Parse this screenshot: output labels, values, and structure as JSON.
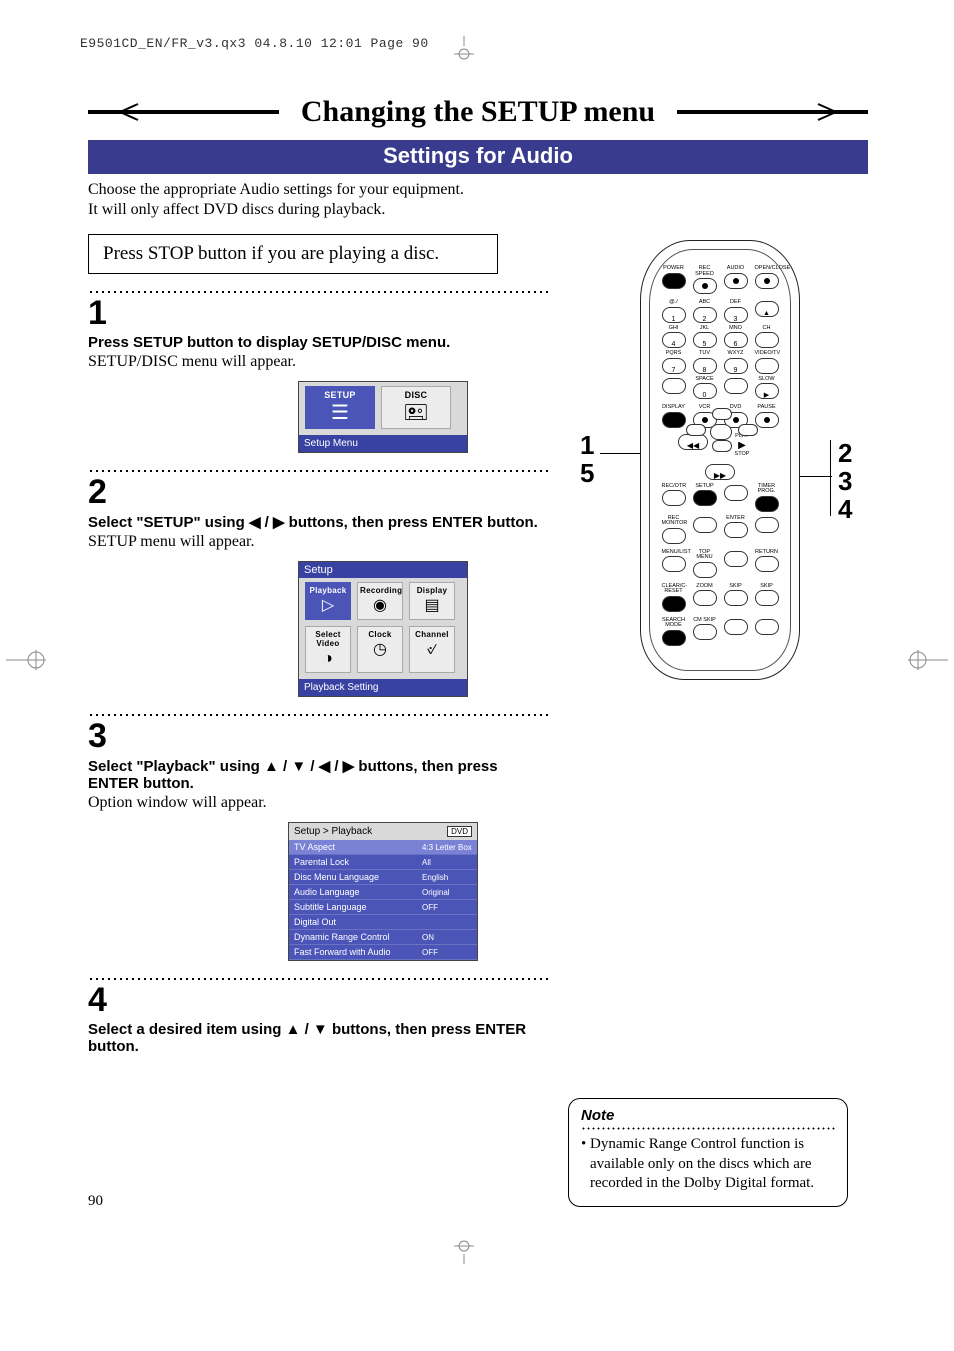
{
  "print_header": "E9501CD_EN/FR_v3.qx3  04.8.10  12:01  Page 90",
  "page_number": "90",
  "title": "Changing the SETUP menu",
  "subtitle": "Settings for Audio",
  "intro_line1": "Choose the appropriate Audio settings for your equipment.",
  "intro_line2": "It will only affect DVD discs during playback.",
  "stop_notice": "Press STOP button if you are playing a disc.",
  "steps": {
    "s1": {
      "num": "1",
      "bold": "Press SETUP button to display SETUP/DISC menu.",
      "text": "SETUP/DISC menu will appear."
    },
    "s2": {
      "num": "2",
      "bold_a": "Select \"SETUP\" using ",
      "bold_b": " buttons, then press ENTER button.",
      "arrows2": "◀ / ▶",
      "text": "SETUP menu will appear."
    },
    "s3": {
      "num": "3",
      "bold_a": "Select \"Playback\" using ",
      "bold_b": " buttons, then press ENTER button.",
      "arrows4": "▲ / ▼ / ◀ / ▶",
      "text": "Option window will appear."
    },
    "s4": {
      "num": "4",
      "bold_a": "Select a desired item using ",
      "bold_b": " buttons, then press ENTER button.",
      "arrows2v": "▲ / ▼"
    }
  },
  "osd1": {
    "cells": {
      "setup": "SETUP",
      "disc": "DISC"
    },
    "footer": "Setup Menu"
  },
  "osd2": {
    "title": "Setup",
    "cells": {
      "playback": "Playback",
      "recording": "Recording",
      "display": "Display",
      "select_video": "Select Video",
      "clock": "Clock",
      "channel": "Channel"
    },
    "footer": "Playback Setting"
  },
  "osd3": {
    "breadcrumb": "Setup > Playback",
    "badge": "DVD",
    "rows": [
      {
        "label": "TV Aspect",
        "value": "4:3 Letter Box"
      },
      {
        "label": "Parental Lock",
        "value": "All"
      },
      {
        "label": "Disc Menu Language",
        "value": "English"
      },
      {
        "label": "Audio Language",
        "value": "Original"
      },
      {
        "label": "Subtitle Language",
        "value": "OFF"
      },
      {
        "label": "Digital Out",
        "value": ""
      },
      {
        "label": "Dynamic Range Control",
        "value": "ON"
      },
      {
        "label": "Fast Forward with Audio",
        "value": "OFF"
      }
    ]
  },
  "remote": {
    "callouts": {
      "left_top": "1",
      "left_bottom": "5",
      "right_1": "2",
      "right_2": "3",
      "right_3": "4"
    },
    "row1": [
      "POWER",
      "REC SPEED",
      "AUDIO",
      "OPEN/CLOSE"
    ],
    "row_digits": [
      {
        "lbl": "@./",
        "d": "1"
      },
      {
        "lbl": "ABC",
        "d": "2"
      },
      {
        "lbl": "DEF",
        "d": "3"
      },
      {
        "lbl": "",
        "d": "▲"
      },
      {
        "lbl": "GHI",
        "d": "4"
      },
      {
        "lbl": "JKL",
        "d": "5"
      },
      {
        "lbl": "MNO",
        "d": "6"
      },
      {
        "lbl": "CH",
        "d": ""
      },
      {
        "lbl": "PQRS",
        "d": "7"
      },
      {
        "lbl": "TUV",
        "d": "8"
      },
      {
        "lbl": "WXYZ",
        "d": "9"
      },
      {
        "lbl": "VIDEO/TV",
        "d": ""
      },
      {
        "lbl": "",
        "d": ""
      },
      {
        "lbl": "SPACE",
        "d": "0"
      },
      {
        "lbl": "",
        "d": ""
      },
      {
        "lbl": "SLOW",
        "d": "▶"
      }
    ],
    "row_mid": [
      "DISPLAY",
      "VCR",
      "DVD",
      "PAUSE"
    ],
    "transport": {
      "rew": "◀◀",
      "play": "PLAY",
      "ff": "▶▶",
      "stop": "STOP"
    },
    "row_setup": [
      "REC/OTR",
      "SETUP",
      "",
      "TIMER PROG."
    ],
    "row_enter": [
      "REC MONITOR",
      "",
      "ENTER",
      ""
    ],
    "row_menu": [
      "MENU/LIST",
      "TOP MENU",
      "",
      "RETURN"
    ],
    "row_zoom": [
      "CLEAR/C-RESET",
      "ZOOM",
      "SKIP",
      "SKIP"
    ],
    "row_last": [
      "SEARCH MODE",
      "CM SKIP",
      "",
      ""
    ]
  },
  "note": {
    "title": "Note",
    "body": "• Dynamic Range Control function is available only on the discs which are recorded in the Dolby Digital format."
  }
}
